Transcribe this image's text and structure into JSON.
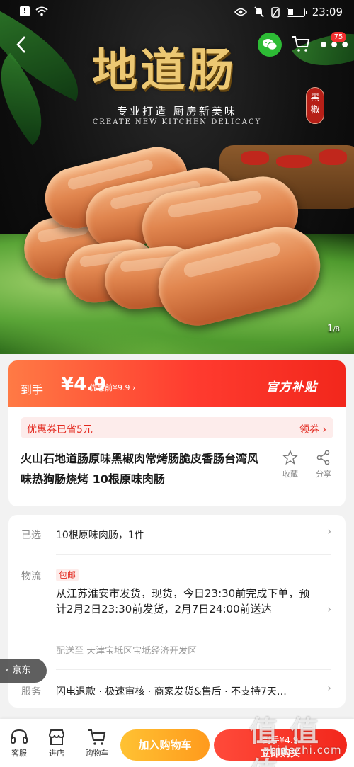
{
  "status_bar": {
    "time": "23:09",
    "alert_glyph": "!"
  },
  "hero": {
    "title": "地道肠",
    "subtitle": "专业打造  厨房新美味",
    "subtitle_en": "CREATE NEW KITCHEN DELICACY",
    "seal": "黑椒",
    "image_index": "1",
    "image_total": "/8",
    "cart_badge": "75"
  },
  "price": {
    "lead": "到手",
    "amount": "¥4.9",
    "before": "优惠前¥9.9 ›",
    "official": "官方补贴"
  },
  "coupon": {
    "text": "优惠券已省5元",
    "action": "领券 ›"
  },
  "product": {
    "title": "火山石地道肠原味黑椒肉常烤肠脆皮香肠台湾风味热狗肠烧烤 10根原味肉肠",
    "fav_label": "收藏",
    "share_label": "分享"
  },
  "info": {
    "selected_label": "已选",
    "selected_value": "10根原味肉肠，1件",
    "logistics_label": "物流",
    "logistics_tag": "包邮",
    "shipping_text": "从江苏淮安市发货，现货，今日23:30前完成下单，预计2月2日23:30前发货，2月7日24:00前送达",
    "deliver_to": "配送至  天津宝坻区宝坻经济开发区",
    "service_label": "服务",
    "service_value": "闪电退款 · 极速审核 · 商家发货&售后 · 不支持7天…"
  },
  "jd_chip": "‹ 京东",
  "bottom_bar": {
    "service_label": "客服",
    "store_label": "进店",
    "cart_label": "购物车",
    "add_cart": "加入购物车",
    "buy_price": "到手¥4.9",
    "buy_label": "立即购买"
  },
  "watermark": {
    "big": "值 值 值",
    "small": "zhidezhi.com"
  },
  "colors": {
    "accent_red": "#f2271c",
    "accent_orange": "#ff9a1c",
    "hero_title_gold": "#ecc873"
  }
}
